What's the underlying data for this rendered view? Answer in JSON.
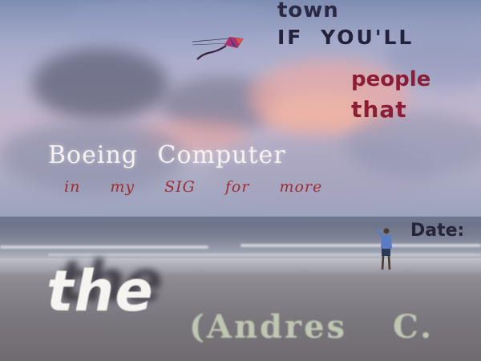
{
  "overlay_text": {
    "town": "town",
    "if_youll": "IF YOU'LL",
    "people": "people",
    "that": "that",
    "boeing_computer": "Boeing Computer",
    "in_my_sig": "in my SIG for more",
    "date": "Date:",
    "the": "the",
    "andres": "(Andres C."
  },
  "colors": {
    "dark_navy_text": "#22223d",
    "maroon_text": "#8b1d36",
    "white_text": "#f5f2ef",
    "red_script_text": "#9c2d33",
    "sage_text": "#bfc6b2"
  },
  "scene": {
    "kite": "kite-icon",
    "person": "person-flying-kite"
  }
}
